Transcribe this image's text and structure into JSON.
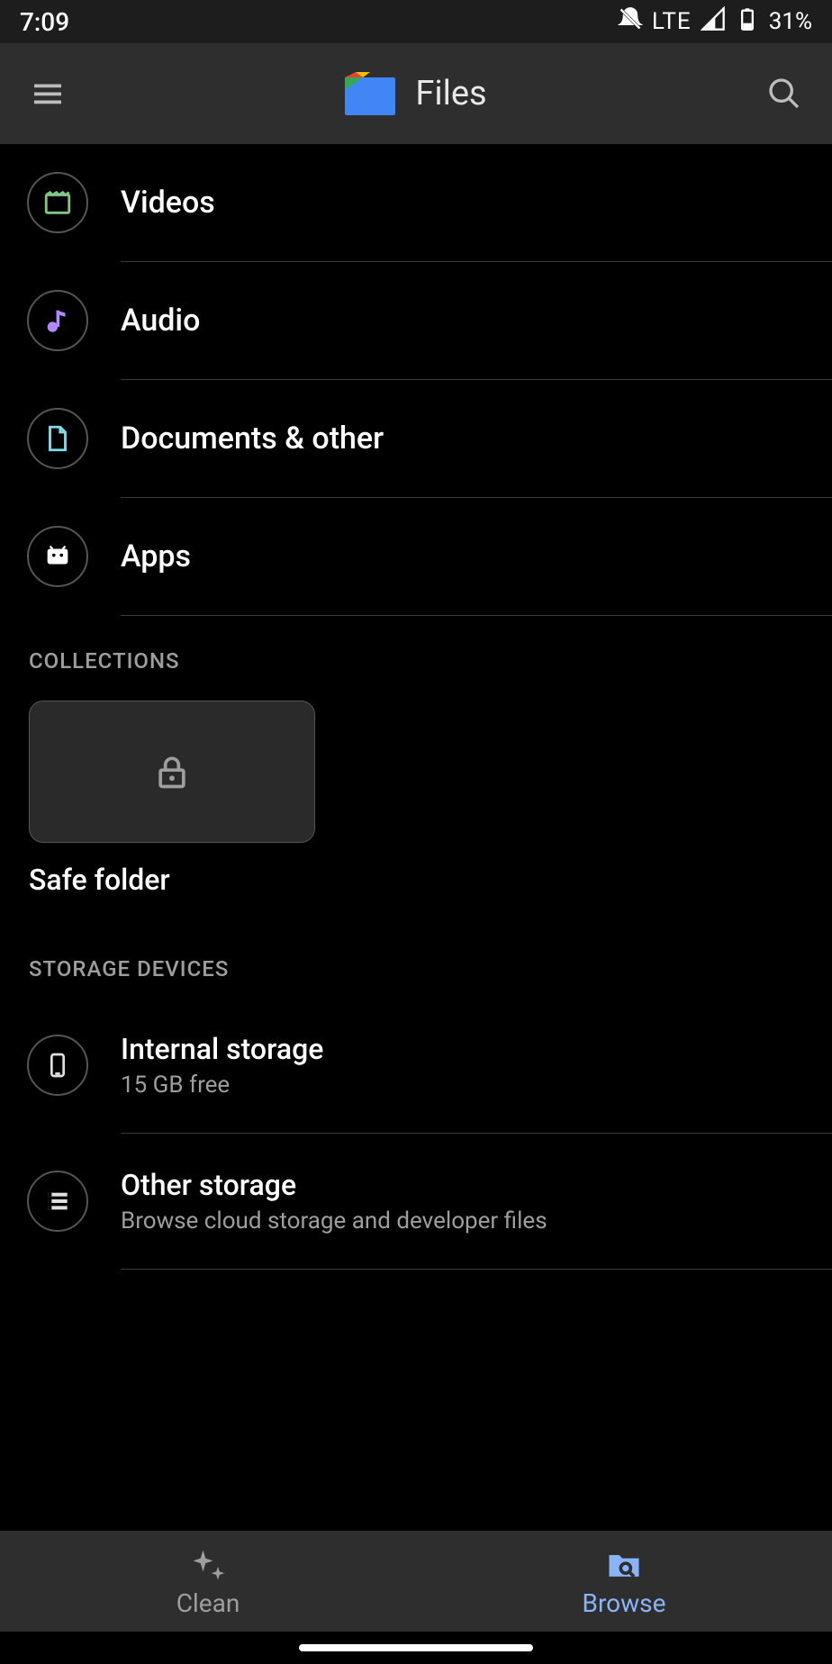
{
  "status": {
    "time": "7:09",
    "network": "LTE",
    "battery": "31%"
  },
  "appbar": {
    "title": "Files"
  },
  "categories": [
    {
      "label": "Videos"
    },
    {
      "label": "Audio"
    },
    {
      "label": "Documents & other"
    },
    {
      "label": "Apps"
    }
  ],
  "sections": {
    "collections": "COLLECTIONS",
    "storage": "STORAGE DEVICES"
  },
  "safe_folder": {
    "label": "Safe folder"
  },
  "storage": [
    {
      "title": "Internal storage",
      "sub": "15 GB free"
    },
    {
      "title": "Other storage",
      "sub": "Browse cloud storage and developer files"
    }
  ],
  "bottomnav": {
    "clean": "Clean",
    "browse": "Browse"
  }
}
